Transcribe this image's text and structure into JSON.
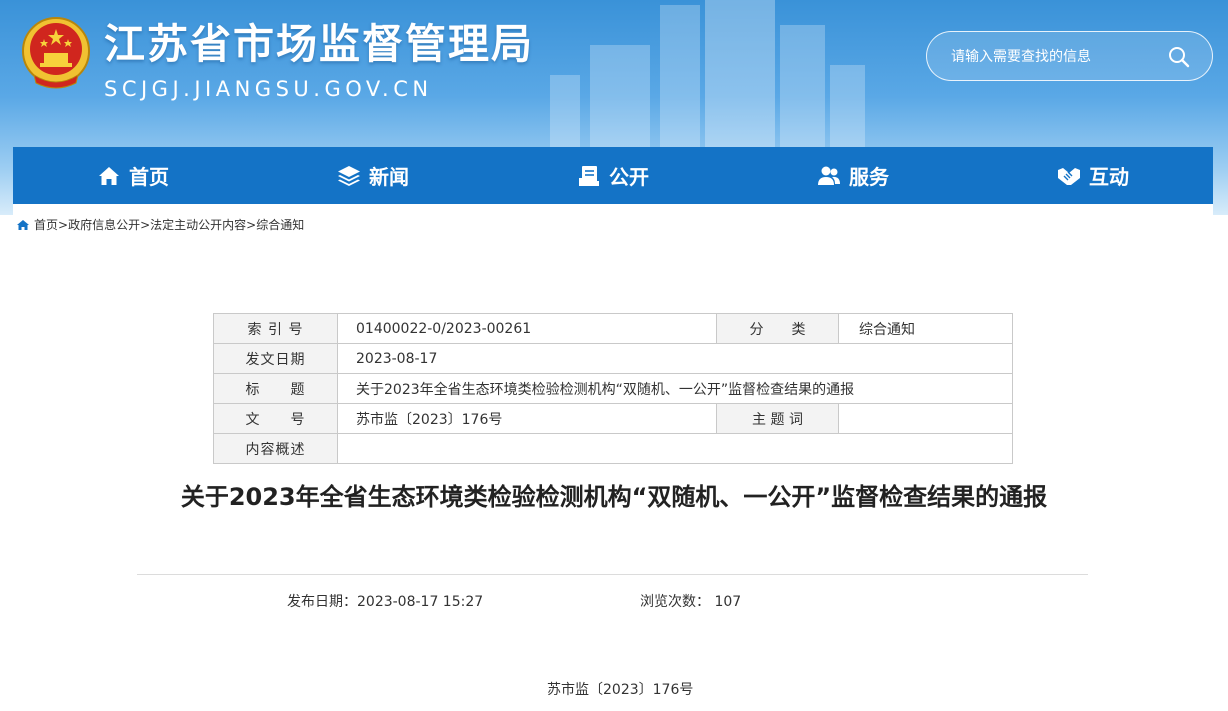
{
  "header": {
    "site_title": "江苏省市场监督管理局",
    "site_domain": "SCJGJ.JIANGSU.GOV.CN",
    "search_placeholder": "请输入需要查找的信息",
    "colors": {
      "brand_blue": "#1473c6",
      "header_top": "#3a92d8"
    }
  },
  "nav": {
    "items": [
      {
        "label": "首页",
        "icon": "home-icon"
      },
      {
        "label": "新闻",
        "icon": "layers-icon"
      },
      {
        "label": "公开",
        "icon": "document-icon"
      },
      {
        "label": "服务",
        "icon": "users-icon"
      },
      {
        "label": "互动",
        "icon": "handshake-icon"
      }
    ]
  },
  "breadcrumb": {
    "items": [
      "首页",
      "政府信息公开",
      "法定主动公开内容",
      "综合通知"
    ],
    "separator": ">"
  },
  "meta": {
    "index_label": "索 引 号",
    "index_value": "01400022-0/2023-00261",
    "category_label": "分　　类",
    "category_value": "综合通知",
    "date_label": "发文日期",
    "date_value": "2023-08-17",
    "title_label": "标　　题",
    "title_value": "关于2023年全省生态环境类检验检测机构“双随机、一公开”监督检查结果的通报",
    "docno_label": "文　　号",
    "docno_value": "苏市监〔2023〕176号",
    "keywords_label": "主 题 词",
    "keywords_value": "",
    "summary_label": "内容概述",
    "summary_value": ""
  },
  "article": {
    "title": "关于2023年全省生态环境类检验检测机构“双随机、一公开”监督检查结果的通报",
    "publish_date": "发布日期：2023-08-17 15:27",
    "views": "浏览次数： 107",
    "doc_number": "苏市监〔2023〕176号"
  }
}
